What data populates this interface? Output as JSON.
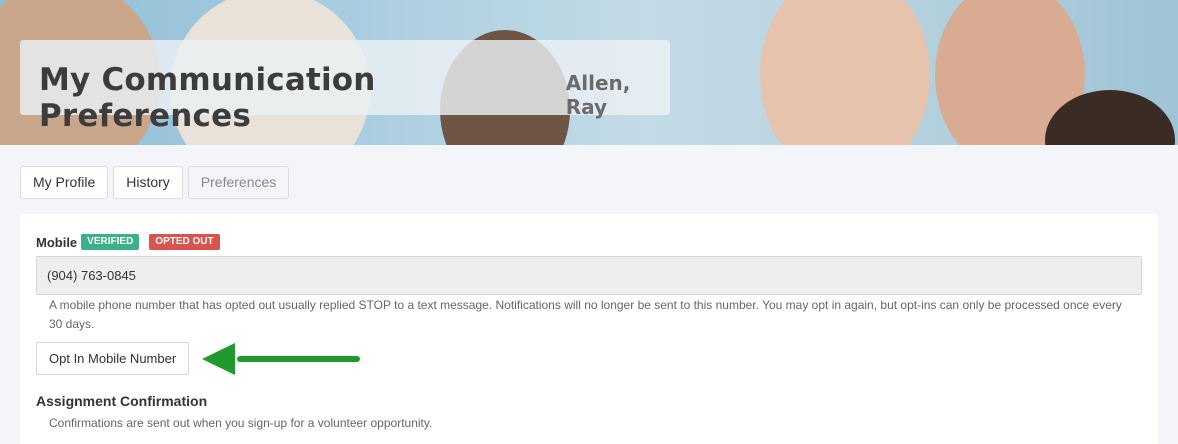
{
  "header": {
    "title": "My Communication Preferences",
    "user_name": "Allen, Ray"
  },
  "tabs": [
    {
      "label": "My Profile",
      "state": "active"
    },
    {
      "label": "History",
      "state": "active"
    },
    {
      "label": "Preferences",
      "state": "inactive"
    }
  ],
  "mobile": {
    "label": "Mobile",
    "badges": [
      {
        "text": "VERIFIED",
        "color": "#3cb08b"
      },
      {
        "text": "OPTED OUT",
        "color": "#d9534f"
      }
    ],
    "value": "(904) 763-0845",
    "help": "A mobile phone number that has opted out usually replied STOP to a text message. Notifications will no longer be sent to this number. You may opt in again, but opt-ins can only be processed once every 30 days.",
    "opt_in_label": "Opt In Mobile Number",
    "arrow_color": "#1f9a2c"
  },
  "assignment": {
    "title": "Assignment Confirmation",
    "help": "Confirmations are sent out when you sign-up for a volunteer opportunity."
  }
}
